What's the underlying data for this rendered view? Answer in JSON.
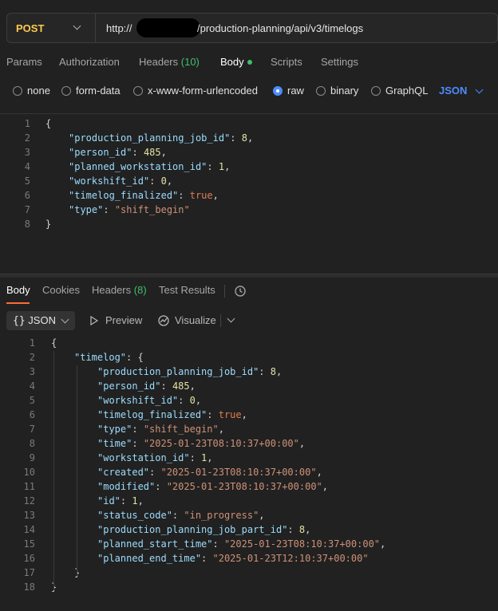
{
  "request": {
    "method": "POST",
    "url_prefix": "http://",
    "url_path": "/production-planning/api/v3/timelogs"
  },
  "request_tabs": [
    {
      "label": "Params"
    },
    {
      "label": "Authorization"
    },
    {
      "label": "Headers",
      "count": "(10)"
    },
    {
      "label": "Body"
    },
    {
      "label": "Scripts"
    },
    {
      "label": "Settings"
    }
  ],
  "body_types": [
    "none",
    "form-data",
    "x-www-form-urlencoded",
    "raw",
    "binary",
    "GraphQL"
  ],
  "selected_body_type": "raw",
  "language": "JSON",
  "request_body": [
    {
      "ln": "1",
      "indent": 0,
      "tokens": [
        {
          "t": "p",
          "v": "{"
        }
      ]
    },
    {
      "ln": "2",
      "indent": 1,
      "tokens": [
        {
          "t": "k",
          "v": "\"production_planning_job_id\""
        },
        {
          "t": "p",
          "v": ": "
        },
        {
          "t": "n",
          "v": "8"
        },
        {
          "t": "p",
          "v": ","
        }
      ]
    },
    {
      "ln": "3",
      "indent": 1,
      "tokens": [
        {
          "t": "k",
          "v": "\"person_id\""
        },
        {
          "t": "p",
          "v": ": "
        },
        {
          "t": "n",
          "v": "485"
        },
        {
          "t": "p",
          "v": ","
        }
      ]
    },
    {
      "ln": "4",
      "indent": 1,
      "tokens": [
        {
          "t": "k",
          "v": "\"planned_workstation_id\""
        },
        {
          "t": "p",
          "v": ": "
        },
        {
          "t": "n",
          "v": "1"
        },
        {
          "t": "p",
          "v": ","
        }
      ]
    },
    {
      "ln": "5",
      "indent": 1,
      "tokens": [
        {
          "t": "k",
          "v": "\"workshift_id\""
        },
        {
          "t": "p",
          "v": ": "
        },
        {
          "t": "n",
          "v": "0"
        },
        {
          "t": "p",
          "v": ","
        }
      ]
    },
    {
      "ln": "6",
      "indent": 1,
      "tokens": [
        {
          "t": "k",
          "v": "\"timelog_finalized\""
        },
        {
          "t": "p",
          "v": ": "
        },
        {
          "t": "b",
          "v": "true"
        },
        {
          "t": "p",
          "v": ","
        }
      ]
    },
    {
      "ln": "7",
      "indent": 1,
      "tokens": [
        {
          "t": "k",
          "v": "\"type\""
        },
        {
          "t": "p",
          "v": ": "
        },
        {
          "t": "s",
          "v": "\"shift_begin\""
        }
      ]
    },
    {
      "ln": "8",
      "indent": 0,
      "tokens": [
        {
          "t": "p",
          "v": "}"
        }
      ]
    }
  ],
  "response_tabs": [
    {
      "label": "Body"
    },
    {
      "label": "Cookies"
    },
    {
      "label": "Headers",
      "count": "(8)"
    },
    {
      "label": "Test Results"
    }
  ],
  "response_toolbar": {
    "format": "JSON",
    "preview": "Preview",
    "visualize": "Visualize"
  },
  "response_body": [
    {
      "ln": "1",
      "indent": 0,
      "tokens": [
        {
          "t": "p",
          "v": "{"
        }
      ]
    },
    {
      "ln": "2",
      "indent": 1,
      "tokens": [
        {
          "t": "k",
          "v": "\"timelog\""
        },
        {
          "t": "p",
          "v": ": {"
        }
      ]
    },
    {
      "ln": "3",
      "indent": 2,
      "tokens": [
        {
          "t": "k",
          "v": "\"production_planning_job_id\""
        },
        {
          "t": "p",
          "v": ": "
        },
        {
          "t": "n",
          "v": "8"
        },
        {
          "t": "p",
          "v": ","
        }
      ]
    },
    {
      "ln": "4",
      "indent": 2,
      "tokens": [
        {
          "t": "k",
          "v": "\"person_id\""
        },
        {
          "t": "p",
          "v": ": "
        },
        {
          "t": "n",
          "v": "485"
        },
        {
          "t": "p",
          "v": ","
        }
      ]
    },
    {
      "ln": "5",
      "indent": 2,
      "tokens": [
        {
          "t": "k",
          "v": "\"workshift_id\""
        },
        {
          "t": "p",
          "v": ": "
        },
        {
          "t": "n",
          "v": "0"
        },
        {
          "t": "p",
          "v": ","
        }
      ]
    },
    {
      "ln": "6",
      "indent": 2,
      "tokens": [
        {
          "t": "k",
          "v": "\"timelog_finalized\""
        },
        {
          "t": "p",
          "v": ": "
        },
        {
          "t": "b",
          "v": "true"
        },
        {
          "t": "p",
          "v": ","
        }
      ]
    },
    {
      "ln": "7",
      "indent": 2,
      "tokens": [
        {
          "t": "k",
          "v": "\"type\""
        },
        {
          "t": "p",
          "v": ": "
        },
        {
          "t": "s",
          "v": "\"shift_begin\""
        },
        {
          "t": "p",
          "v": ","
        }
      ]
    },
    {
      "ln": "8",
      "indent": 2,
      "tokens": [
        {
          "t": "k",
          "v": "\"time\""
        },
        {
          "t": "p",
          "v": ": "
        },
        {
          "t": "s",
          "v": "\"2025-01-23T08:10:37+00:00\""
        },
        {
          "t": "p",
          "v": ","
        }
      ]
    },
    {
      "ln": "9",
      "indent": 2,
      "tokens": [
        {
          "t": "k",
          "v": "\"workstation_id\""
        },
        {
          "t": "p",
          "v": ": "
        },
        {
          "t": "n",
          "v": "1"
        },
        {
          "t": "p",
          "v": ","
        }
      ]
    },
    {
      "ln": "10",
      "indent": 2,
      "tokens": [
        {
          "t": "k",
          "v": "\"created\""
        },
        {
          "t": "p",
          "v": ": "
        },
        {
          "t": "s",
          "v": "\"2025-01-23T08:10:37+00:00\""
        },
        {
          "t": "p",
          "v": ","
        }
      ]
    },
    {
      "ln": "11",
      "indent": 2,
      "tokens": [
        {
          "t": "k",
          "v": "\"modified\""
        },
        {
          "t": "p",
          "v": ": "
        },
        {
          "t": "s",
          "v": "\"2025-01-23T08:10:37+00:00\""
        },
        {
          "t": "p",
          "v": ","
        }
      ]
    },
    {
      "ln": "12",
      "indent": 2,
      "tokens": [
        {
          "t": "k",
          "v": "\"id\""
        },
        {
          "t": "p",
          "v": ": "
        },
        {
          "t": "n",
          "v": "1"
        },
        {
          "t": "p",
          "v": ","
        }
      ]
    },
    {
      "ln": "13",
      "indent": 2,
      "tokens": [
        {
          "t": "k",
          "v": "\"status_code\""
        },
        {
          "t": "p",
          "v": ": "
        },
        {
          "t": "s",
          "v": "\"in_progress\""
        },
        {
          "t": "p",
          "v": ","
        }
      ]
    },
    {
      "ln": "14",
      "indent": 2,
      "tokens": [
        {
          "t": "k",
          "v": "\"production_planning_job_part_id\""
        },
        {
          "t": "p",
          "v": ": "
        },
        {
          "t": "n",
          "v": "8"
        },
        {
          "t": "p",
          "v": ","
        }
      ]
    },
    {
      "ln": "15",
      "indent": 2,
      "tokens": [
        {
          "t": "k",
          "v": "\"planned_start_time\""
        },
        {
          "t": "p",
          "v": ": "
        },
        {
          "t": "s",
          "v": "\"2025-01-23T08:10:37+00:00\""
        },
        {
          "t": "p",
          "v": ","
        }
      ]
    },
    {
      "ln": "16",
      "indent": 2,
      "tokens": [
        {
          "t": "k",
          "v": "\"planned_end_time\""
        },
        {
          "t": "p",
          "v": ": "
        },
        {
          "t": "s",
          "v": "\"2025-01-23T12:10:37+00:00\""
        }
      ]
    },
    {
      "ln": "17",
      "indent": 1,
      "tokens": [
        {
          "t": "p",
          "v": "}"
        }
      ]
    },
    {
      "ln": "18",
      "indent": 0,
      "tokens": [
        {
          "t": "p",
          "v": "}"
        }
      ]
    }
  ],
  "colors": {
    "method": "#ffc94d",
    "accent": "#ff6c37",
    "link": "#4e8cff",
    "success": "#3fbf6b",
    "json_key": "#9cdcfe",
    "json_string": "#ce9178",
    "json_number": "#e2e2a6",
    "json_boolean": "#e07b53"
  }
}
